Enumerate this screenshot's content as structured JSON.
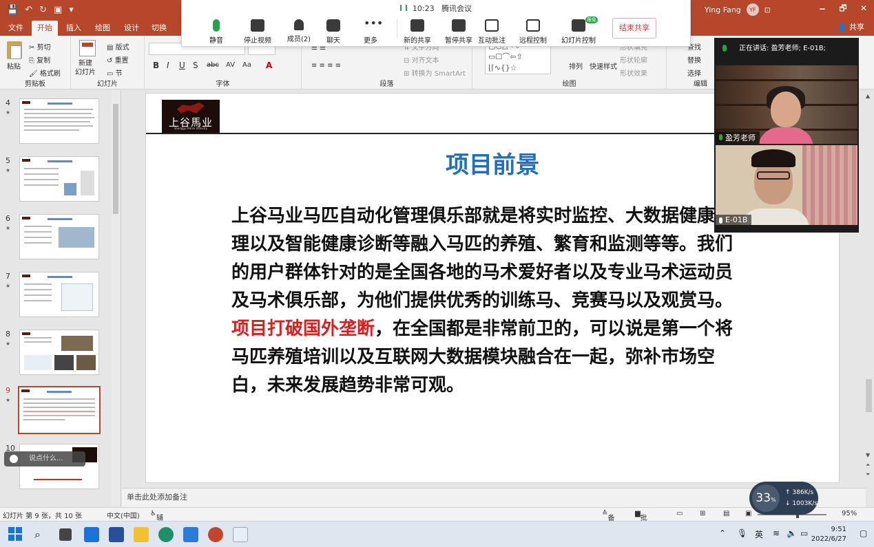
{
  "titlebar": {
    "user_name": "Ying Fang",
    "user_initials": "YF",
    "controls": [
      "🗕",
      "🗗",
      "✕"
    ]
  },
  "ribbon_tabs": [
    "文件",
    "开始",
    "插入",
    "绘图",
    "设计",
    "切换"
  ],
  "share_label": "共享",
  "ribbon": {
    "clipboard": {
      "paste": "粘贴",
      "cut": "剪切",
      "copy": "复制",
      "format_painter": "格式刷",
      "group": "剪贴板"
    },
    "slides": {
      "new_slide": "新建\n幻灯片",
      "layout": "版式",
      "reset": "重置",
      "section": "节",
      "group": "幻灯片"
    },
    "font": {
      "group": "字体"
    },
    "paragraph": {
      "text_direction": "文字方向",
      "align_text": "对齐文本",
      "smartart": "转换为 SmartArt",
      "group": "段落"
    },
    "drawing": {
      "arrange": "排列",
      "quick_styles": "快速样式",
      "shape_fill": "形状填充",
      "shape_outline": "形状轮廓",
      "shape_effects": "形状效果",
      "group": "绘图"
    },
    "editing": {
      "find": "查找",
      "replace": "替换",
      "select": "选择",
      "group": "编辑"
    }
  },
  "meeting": {
    "time": "10:23",
    "app_name": "腾讯会议",
    "buttons": [
      {
        "label": "静音",
        "icon": "mic-icon"
      },
      {
        "label": "停止视频",
        "icon": "video-icon"
      },
      {
        "label": "成员(2)",
        "icon": "members-icon"
      },
      {
        "label": "聊天",
        "icon": "chat-icon"
      },
      {
        "label": "更多",
        "icon": "more-icon"
      },
      {
        "label": "新的共享",
        "icon": "share-icon"
      },
      {
        "label": "暂停共享",
        "icon": "pause-icon"
      },
      {
        "label": "互动批注",
        "icon": "annotate-icon"
      },
      {
        "label": "远程控制",
        "icon": "remote-control-icon"
      },
      {
        "label": "幻灯片控制",
        "icon": "slide-control-icon"
      }
    ],
    "slide_control_badge": "限免",
    "end_share": "结束共享"
  },
  "thumbnails": [
    {
      "num": "4"
    },
    {
      "num": "5"
    },
    {
      "num": "6"
    },
    {
      "num": "7"
    },
    {
      "num": "8"
    },
    {
      "num": "9",
      "selected": true
    },
    {
      "num": "10"
    }
  ],
  "chat_placeholder": "说点什么...",
  "slide": {
    "logo_name": "上谷馬业",
    "logo_sub": "Shanggu Horse Industry",
    "title": "项目前景",
    "body_part1": "上谷马业马匹自动化管理俱乐部就是将实时监控、大数据健康管理以及智能健康诊断等融入马匹的养殖、繁育和监测等等。我们的用户群体针对的是全国各地的马术爱好者以及专业马术运动员及马术俱乐部，为他们提供优秀的训练马、竞赛马以及观赏马。",
    "body_red": "项目打破国外垄断",
    "body_part2": "，在全国都是非常前卫的，可以说是第一个将马匹养殖培训以及互联网大数据模块融合在一起，弥补市场空白，未来发展趋势非常可观。"
  },
  "notes_placeholder": "单击此处添加备注",
  "statusbar": {
    "slide_info": "幻灯片 第 9 张，共 10 张",
    "language": "中文(中国)",
    "accessibility": "辅助功能: 调查",
    "notes": "备注",
    "comments": "批注",
    "zoom": "95%"
  },
  "video_panel": {
    "speaking": "正在讲话: 盈芳老师; E-01B;",
    "participants": [
      "盈芳老师",
      "E-01B"
    ]
  },
  "speed_widget": {
    "percent": "33",
    "up": "386",
    "down": "1003",
    "unit": "K/s"
  },
  "taskbar": {
    "ime": "英",
    "time": "9:51",
    "date": "2022/6/27"
  }
}
